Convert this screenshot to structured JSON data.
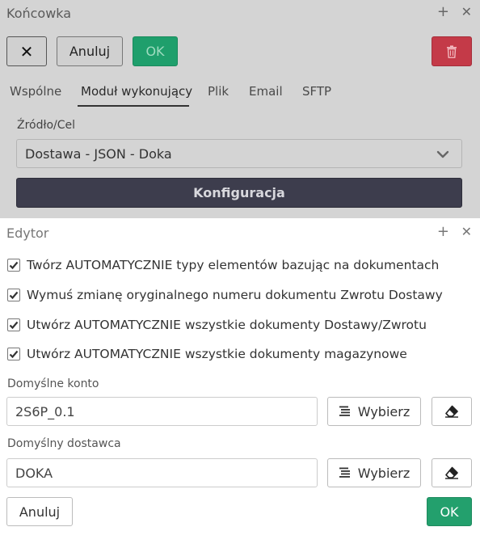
{
  "background_dialog": {
    "title": "Końcowka",
    "toolbar": {
      "close_label": "✕",
      "cancel_label": "Anuluj",
      "ok_label": "OK",
      "delete_icon": "trash-icon"
    },
    "tabs": [
      {
        "label": "Wspólne",
        "active": false
      },
      {
        "label": "Moduł wykonujący",
        "active": true
      },
      {
        "label": "Plik",
        "active": false
      },
      {
        "label": "Email",
        "active": false
      },
      {
        "label": "SFTP",
        "active": false
      }
    ],
    "source_label": "Źródło/Cel",
    "source_value": "Dostawa - JSON - Doka",
    "config_button_label": "Konfiguracja"
  },
  "editor_dialog": {
    "title": "Edytor",
    "checkboxes": [
      {
        "label": "Twórz AUTOMATYCZNIE typy elementów bazując na dokumentach",
        "checked": true
      },
      {
        "label": "Wymuś zmianę oryginalnego numeru dokumentu Zwrotu Dostawy",
        "checked": true
      },
      {
        "label": "Utwórz AUTOMATYCZNIE wszystkie dokumenty Dostawy/Zwrotu",
        "checked": true
      },
      {
        "label": "Utwórz AUTOMATYCZNIE wszystkie dokumenty magazynowe",
        "checked": true
      }
    ],
    "default_account": {
      "label": "Domyślne konto",
      "value": "2S6P_0.1",
      "select_label": "Wybierz"
    },
    "default_supplier": {
      "label": "Domyślny dostawca",
      "value": "DOKA",
      "select_label": "Wybierz"
    },
    "cancel_label": "Anuluj",
    "ok_label": "OK"
  },
  "window_controls": {
    "plus": "+",
    "close": "✕"
  },
  "colors": {
    "ok_green": "#23a06d",
    "danger_red": "#c43a48",
    "config_dark": "#3d3d4d",
    "overlay_gray": "#d4d4d4"
  }
}
